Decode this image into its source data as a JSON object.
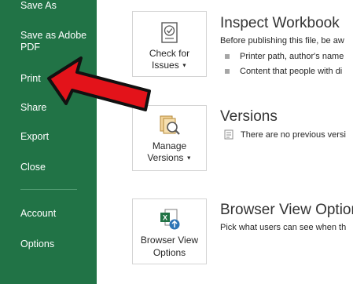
{
  "sidebar": {
    "items": [
      {
        "id": "save-as",
        "label": "Save As"
      },
      {
        "id": "save-as-pdf",
        "label": "Save as Adobe PDF"
      },
      {
        "id": "print",
        "label": "Print"
      },
      {
        "id": "share",
        "label": "Share"
      },
      {
        "id": "export",
        "label": "Export"
      },
      {
        "id": "close",
        "label": "Close"
      },
      {
        "id": "account",
        "label": "Account"
      },
      {
        "id": "options",
        "label": "Options"
      }
    ]
  },
  "sections": {
    "inspect": {
      "tile_label_line1": "Check for",
      "tile_label_line2": "Issues",
      "tile_icon": "check-document-icon",
      "title": "Inspect Workbook",
      "description": "Before publishing this file, be aw",
      "bullets": [
        "Printer path, author's name",
        "Content that people with di"
      ]
    },
    "versions": {
      "tile_label_line1": "Manage",
      "tile_label_line2": "Versions",
      "tile_icon": "manage-versions-icon",
      "title": "Versions",
      "description": "There are no previous versi"
    },
    "browser_view": {
      "tile_label_line1": "Browser View",
      "tile_label_line2": "Options",
      "tile_icon": "excel-browser-icon",
      "title": "Browser View Option",
      "description": "Pick what users can see when th"
    }
  },
  "colors": {
    "sidebar": "#217346",
    "arrow": "#e3131a",
    "accent_blue": "#2e75b6"
  }
}
